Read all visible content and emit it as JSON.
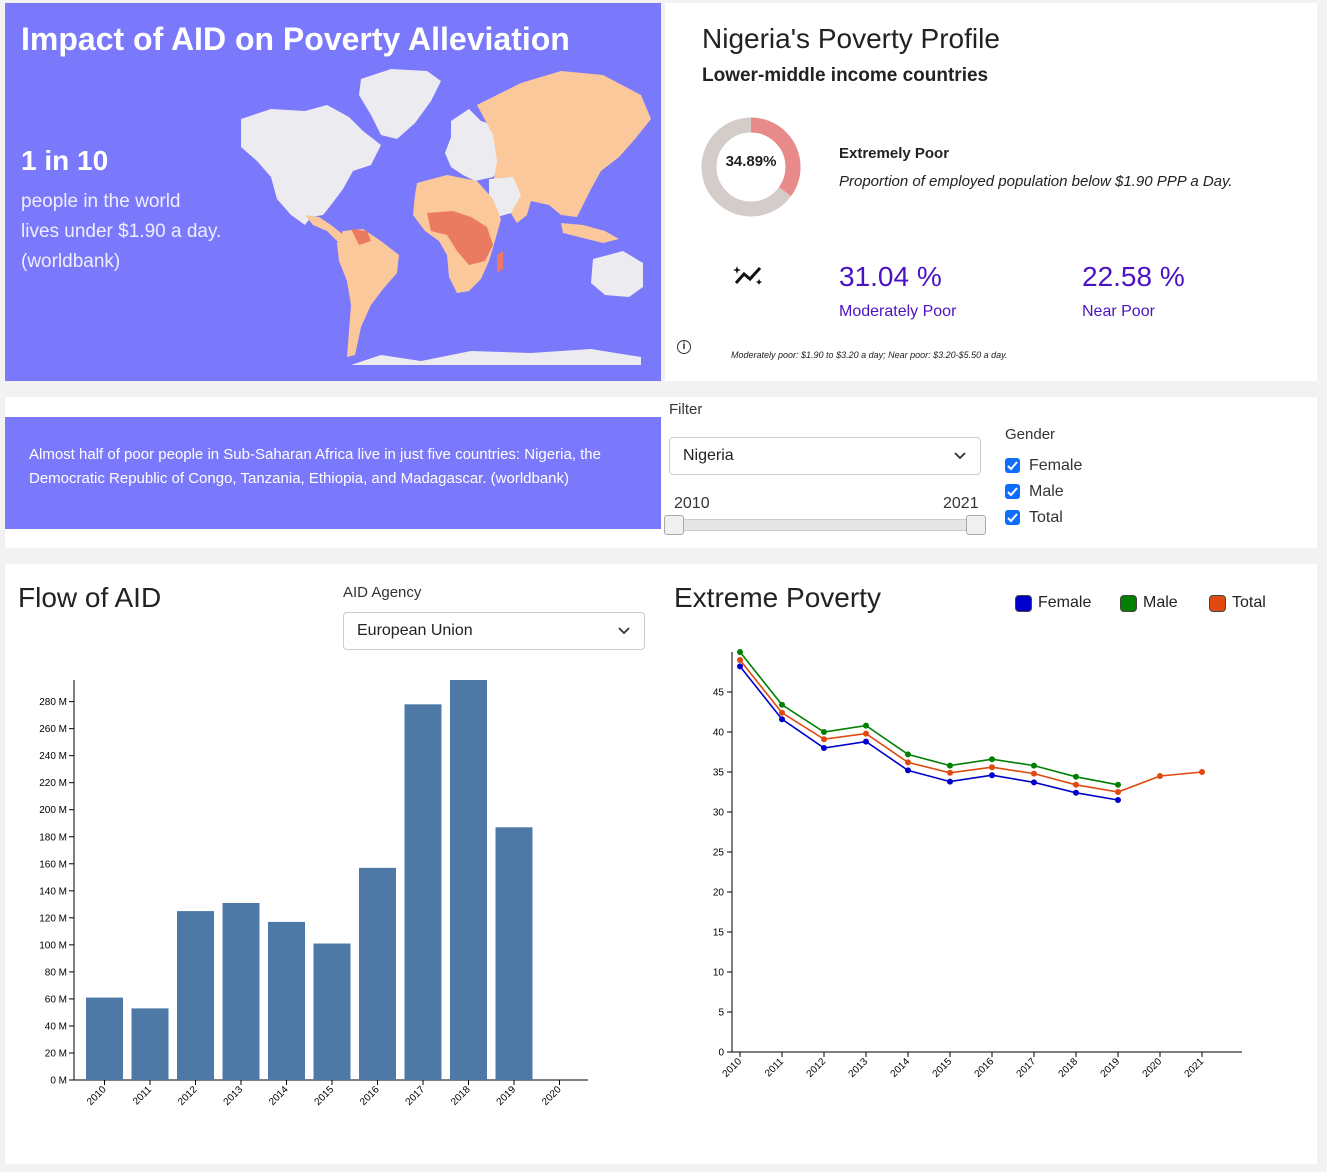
{
  "hero": {
    "title": "Impact of AID on Poverty Alleviation",
    "stat": "1 in 10",
    "desc_lines": [
      "people in the world",
      "lives under $1.90 a day.",
      "(worldbank)"
    ]
  },
  "profile": {
    "title": "Nigeria's Poverty Profile",
    "subtitle": "Lower-middle income countries",
    "extreme": {
      "value_label": "34.89%",
      "fraction": 0.3489,
      "title": "Extremely Poor",
      "desc": "Proportion of employed population below $1.90 PPP a Day."
    },
    "moderate": {
      "value": "31.04 %",
      "label": "Moderately Poor"
    },
    "near": {
      "value": "22.58 %",
      "label": "Near Poor"
    },
    "footnote": "Moderately poor: $1.90 to $3.20 a day; Near poor: $3.20-$5.50 a day."
  },
  "fact": "Almost half of poor people in Sub-Saharan Africa live in just five countries: Nigeria, the Democratic Republic of Congo, Tanzania, Ethiopia, and Madagascar. (worldbank)",
  "filter": {
    "label": "Filter",
    "country": "Nigeria",
    "year_min": "2010",
    "year_max": "2021",
    "gender_label": "Gender",
    "genders": [
      "Female",
      "Male",
      "Total"
    ]
  },
  "aid": {
    "title": "Flow of AID",
    "agency_label": "AID Agency",
    "agency": "European Union"
  },
  "poverty": {
    "title": "Extreme Poverty",
    "legend": [
      "Female",
      "Male",
      "Total"
    ]
  },
  "colors": {
    "purple": "#7b79fb",
    "bar": "#4e79a7",
    "female": "#0000cc",
    "male": "#008000",
    "total": "#e04a10",
    "donut": "#e88a8a",
    "donut_bg": "#d4ccc8"
  },
  "chart_data": [
    {
      "type": "bar",
      "title": "Flow of AID",
      "categories": [
        "2010",
        "2011",
        "2012",
        "2013",
        "2014",
        "2015",
        "2016",
        "2017",
        "2018",
        "2019",
        "2020"
      ],
      "values": [
        61,
        53,
        125,
        131,
        117,
        101,
        157,
        278,
        296,
        187,
        null
      ],
      "unit": "M",
      "ylim": [
        0,
        296
      ],
      "yticks": [
        "0 M",
        "20 M",
        "40 M",
        "60 M",
        "80 M",
        "100 M",
        "120 M",
        "140 M",
        "160 M",
        "180 M",
        "200 M",
        "220 M",
        "240 M",
        "260 M",
        "280 M"
      ]
    },
    {
      "type": "line",
      "title": "Extreme Poverty",
      "x": [
        "2010",
        "2011",
        "2012",
        "2013",
        "2014",
        "2015",
        "2016",
        "2017",
        "2018",
        "2019",
        "2020",
        "2021"
      ],
      "ylim": [
        0,
        50
      ],
      "yticks": [
        "0",
        "5",
        "10",
        "15",
        "20",
        "25",
        "30",
        "35",
        "40",
        "45"
      ],
      "series": [
        {
          "name": "Female",
          "values": [
            48.2,
            41.6,
            38.0,
            38.8,
            35.2,
            33.8,
            34.6,
            33.7,
            32.4,
            31.5,
            null,
            null
          ]
        },
        {
          "name": "Male",
          "values": [
            50.0,
            43.4,
            40.0,
            40.8,
            37.2,
            35.8,
            36.6,
            35.8,
            34.4,
            33.4,
            null,
            null
          ]
        },
        {
          "name": "Total",
          "values": [
            49.0,
            42.4,
            39.1,
            39.8,
            36.2,
            34.9,
            35.6,
            34.8,
            33.4,
            32.5,
            34.5,
            35.0
          ]
        }
      ]
    }
  ]
}
